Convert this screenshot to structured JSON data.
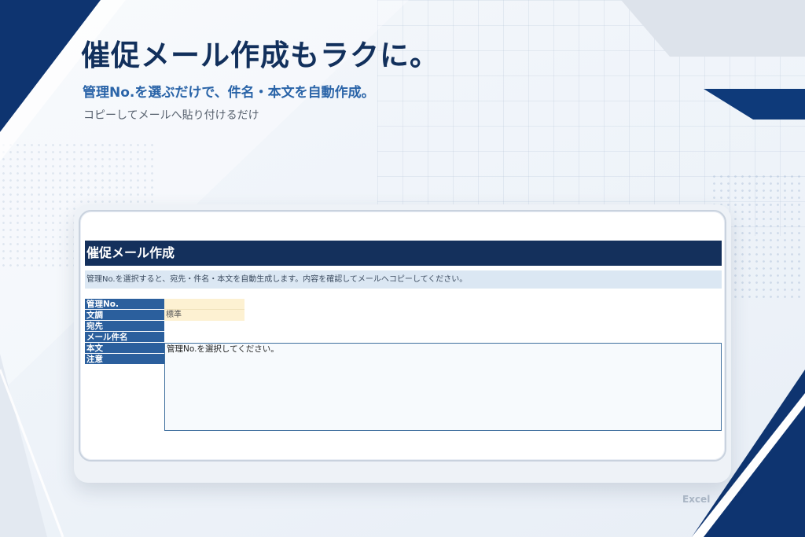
{
  "hero": {
    "headline": "催促メール作成もラクに。",
    "subhead": "管理No.を選ぶだけで、件名・本文を自動作成。",
    "caption": "コピーしてメールへ貼り付けるだけ"
  },
  "sheet": {
    "title": "催促メール作成",
    "description": "管理No.を選択すると、宛先・件名・本文を自動生成します。内容を確認してメールへコピーしてください。",
    "fields": [
      {
        "label": "管理No.",
        "value": ""
      },
      {
        "label": "文調",
        "value": "標準"
      },
      {
        "label": "宛先",
        "value": ""
      },
      {
        "label": "メール件名",
        "value": ""
      },
      {
        "label": "本文",
        "value": "管理No.を選択してください。"
      },
      {
        "label": "注意",
        "value": ""
      }
    ]
  },
  "watermark": "Excel",
  "colors": {
    "navy": "#14305c",
    "label_blue": "#2b5f9d",
    "input_yellow": "#fdf1d2",
    "desc_bg": "#dbe7f3",
    "accent_blue": "#2a64a8"
  }
}
